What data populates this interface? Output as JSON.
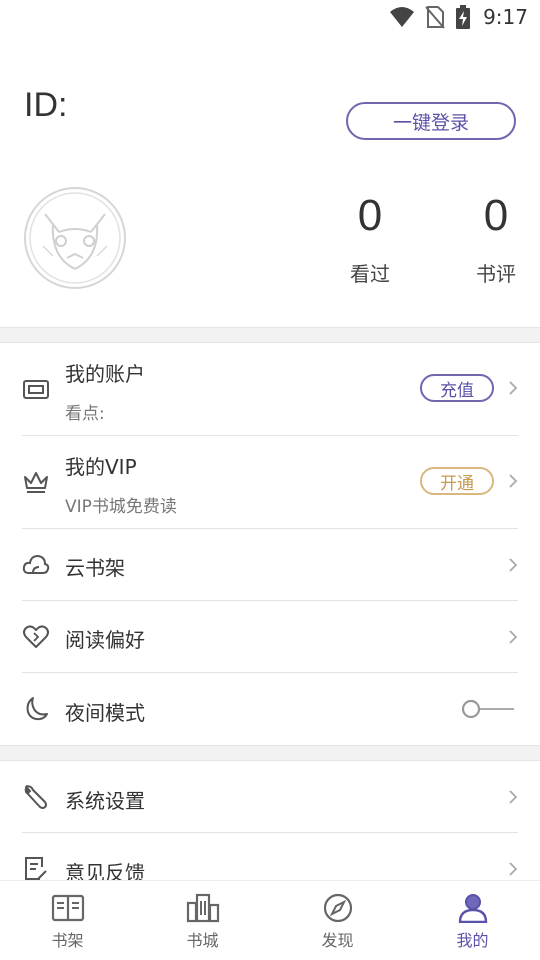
{
  "status_bar": {
    "time": "9:17"
  },
  "profile": {
    "id_label": "ID:",
    "login_button": "一键登录",
    "stats": [
      {
        "value": "0",
        "label": "看过"
      },
      {
        "value": "0",
        "label": "书评"
      }
    ]
  },
  "menu": {
    "account": {
      "title": "我的账户",
      "subtitle": "看点:",
      "action": "充值"
    },
    "vip": {
      "title": "我的VIP",
      "subtitle": "VIP书城免费读",
      "action": "开通"
    },
    "cloud_shelf": {
      "title": "云书架"
    },
    "reading_pref": {
      "title": "阅读偏好"
    },
    "night_mode": {
      "title": "夜间模式",
      "enabled": false
    },
    "settings": {
      "title": "系统设置"
    },
    "feedback": {
      "title": "意见反馈"
    }
  },
  "tabs": [
    {
      "label": "书架",
      "icon": "bookshelf-icon"
    },
    {
      "label": "书城",
      "icon": "bookstore-icon"
    },
    {
      "label": "发现",
      "icon": "compass-icon"
    },
    {
      "label": "我的",
      "icon": "user-icon",
      "active": true
    }
  ],
  "colors": {
    "accent": "#5a52a8",
    "vip_gold": "#c79a50",
    "separator": "#f2f2f2"
  }
}
